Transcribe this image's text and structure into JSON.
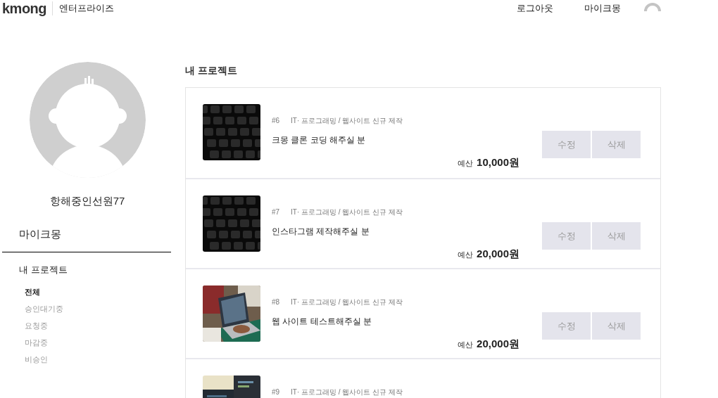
{
  "header": {
    "logo": "kmong",
    "section": "엔터프라이즈",
    "nav": [
      "로그아웃",
      "마이크몽"
    ]
  },
  "profile": {
    "name": "항해중인선원77"
  },
  "sidebar": {
    "title": "마이크몽",
    "group": "내 프로젝트",
    "items": [
      {
        "label": "전체",
        "selected": true
      },
      {
        "label": "승인대기중",
        "selected": false
      },
      {
        "label": "요청중",
        "selected": false
      },
      {
        "label": "마감중",
        "selected": false
      },
      {
        "label": "비승인",
        "selected": false
      }
    ]
  },
  "main": {
    "title": "내 프로젝트",
    "projects": [
      {
        "number": "#6",
        "category": "IT· 프로그래밍 / 웹사이트 신규 제작",
        "title": "크몽 클론 코딩 해주실 분",
        "budget_label": "예산",
        "budget": "10,000원",
        "buttons": [
          "수정",
          "삭제"
        ]
      },
      {
        "number": "#7",
        "category": "IT· 프로그래밍 / 웹사이트 신규 제작",
        "title": "인스타그램 제작해주실 분",
        "budget_label": "예산",
        "budget": "20,000원",
        "buttons": [
          "수정",
          "삭제"
        ]
      },
      {
        "number": "#8",
        "category": "IT· 프로그래밍 / 웹사이트 신규 제작",
        "title": "웹 사이트 테스트해주실 분",
        "budget_label": "예산",
        "budget": "20,000원",
        "buttons": [
          "수정",
          "삭제"
        ]
      },
      {
        "number": "#9",
        "category": "IT· 프로그래밍 / 웹사이트 신규 제작"
      }
    ]
  }
}
